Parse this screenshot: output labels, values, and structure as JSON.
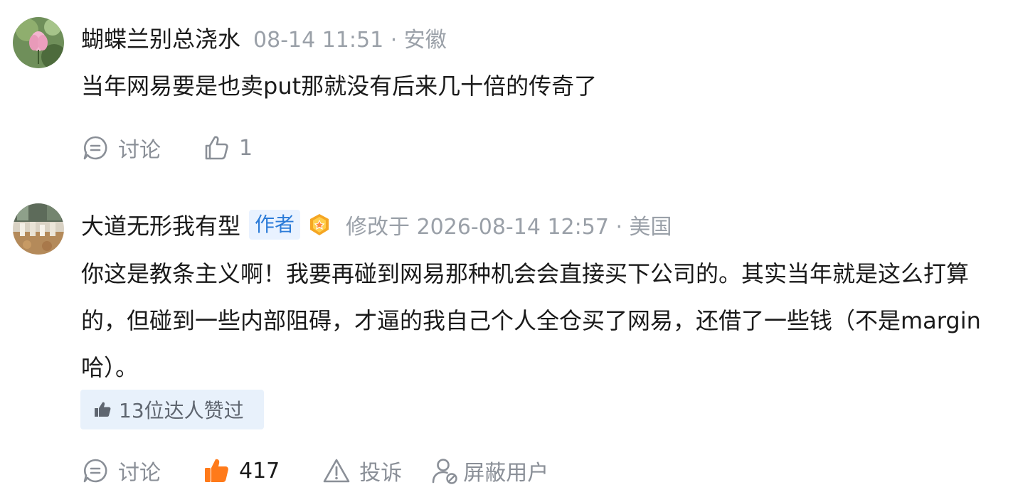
{
  "comments": [
    {
      "username": "蝴蝶兰别总浇水",
      "meta": "08-14 11:51 · 安徽",
      "text": "当年网易要是也卖put那就没有后来几十倍的传奇了",
      "discuss_label": "讨论",
      "like_count": "1"
    },
    {
      "username": "大道无形我有型",
      "author_badge": "作者",
      "meta": "修改于 2026-08-14 12:57 · 美国",
      "text": "你这是教条主义啊！我要再碰到网易那种机会会直接买下公司的。其实当年就是这么打算的，但碰到一些内部阻碍，才逼的我自己个人全仓买了网易，还借了一些钱（不是margin哈）。",
      "experts_liked": "13位达人赞过",
      "discuss_label": "讨论",
      "like_count": "417",
      "report_label": "投诉",
      "block_label": "屏蔽用户"
    }
  ],
  "icons": {
    "discuss": "discuss-icon",
    "like": "thumbs-up-icon",
    "report": "warning-icon",
    "block": "block-user-icon",
    "medal": "medal-icon"
  },
  "colors": {
    "meta_gray": "#9aa0a8",
    "action_gray": "#8a8f97",
    "author_blue": "#2b7bd8",
    "author_bg": "#e9f2ff",
    "liked_orange": "#ff7a1a",
    "experts_bg": "#e8f1fb"
  }
}
